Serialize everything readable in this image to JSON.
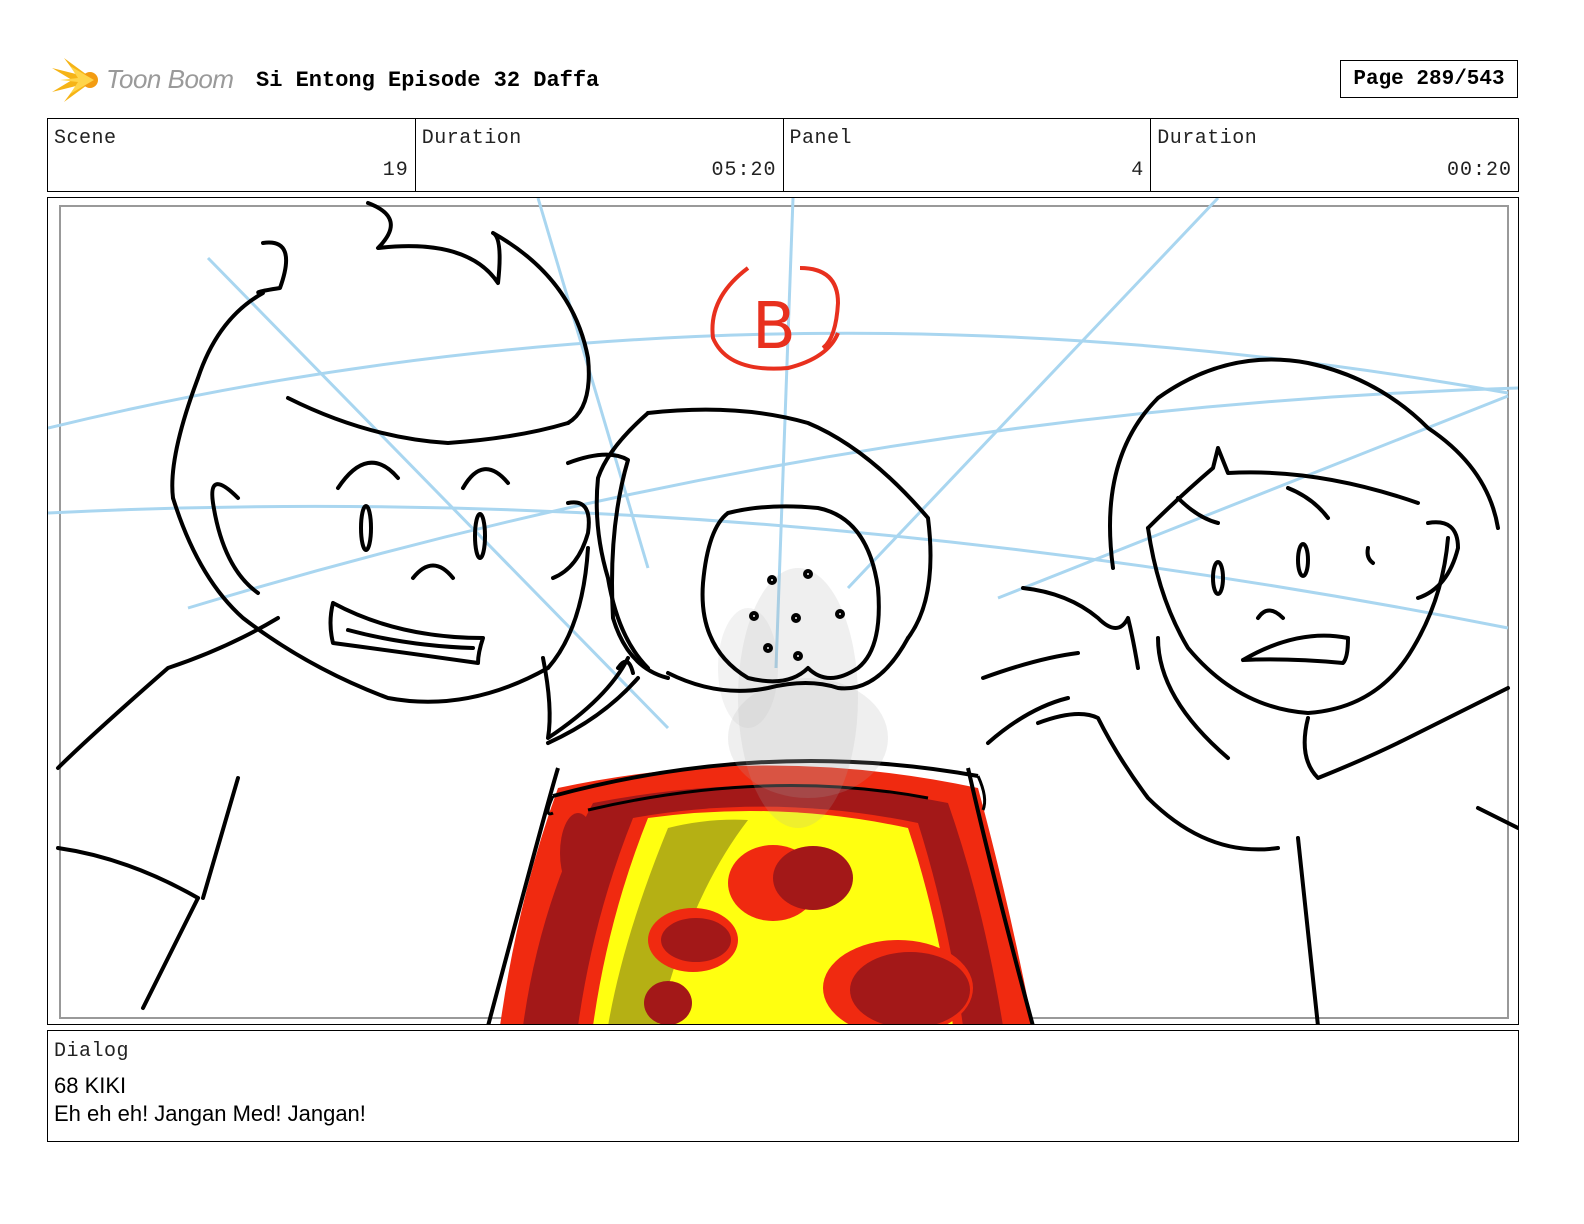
{
  "header": {
    "logo_text": "Toon Boom",
    "title": "Si Entong Episode 32 Daffa",
    "page_label": "Page 289/543"
  },
  "info": {
    "scene_label": "Scene",
    "scene_value": "19",
    "scene_duration_label": "Duration",
    "scene_duration_value": "05:20",
    "panel_label": "Panel",
    "panel_value": "4",
    "panel_duration_label": "Duration",
    "panel_duration_value": "00:20"
  },
  "panel": {
    "annotation": "B"
  },
  "dialog": {
    "label": "Dialog",
    "line1": "68 KIKI",
    "line2": "Eh eh eh! Jangan Med! Jangan!"
  }
}
